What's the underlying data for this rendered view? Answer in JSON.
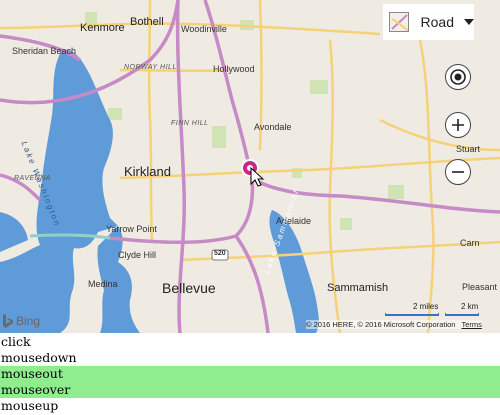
{
  "map": {
    "style_picker": {
      "label": "Road"
    },
    "cities": {
      "kenmore": "Kenmore",
      "bothell": "Bothell",
      "woodinville": "Woodinville",
      "sheridan_beach": "Sheridan Beach",
      "norway_hill": "NORWAY HILL",
      "hollywood": "Hollywood",
      "finn_hill": "FINN HILL",
      "avondale": "Avondale",
      "stuart": "Stuart",
      "kirkland": "Kirkland",
      "ravenna": "RAVENNA",
      "yarrow_point": "Yarrow Point",
      "adelaide": "Adelaide",
      "clyde_hill": "Clyde Hill",
      "medina": "Medina",
      "bellevue": "Bellevue",
      "sammamish": "Sammamish",
      "pleasant": "Pleasant",
      "carn": "Carn"
    },
    "water_labels": {
      "lake_washington": "Lake Washington",
      "lake_sammamish": "Lake Sammamish"
    },
    "road_shield": "520",
    "logo_text": "Bing",
    "scale": {
      "miles": "2 miles",
      "km": "2 km"
    },
    "copyright": "© 2016 HERE, © 2016 Microsoft Corporation",
    "terms": "Terms"
  },
  "event_log": [
    {
      "text": "click",
      "highlighted": false
    },
    {
      "text": "mousedown",
      "highlighted": false
    },
    {
      "text": "mouseout",
      "highlighted": true
    },
    {
      "text": "mouseover",
      "highlighted": true
    },
    {
      "text": "mouseup",
      "highlighted": false
    }
  ],
  "colors": {
    "water": "#5f9bd8",
    "highway": "#c68ac6",
    "arterial": "#f5d27a",
    "pushpin": "#c9288a",
    "highlight": "#8fec8f"
  }
}
